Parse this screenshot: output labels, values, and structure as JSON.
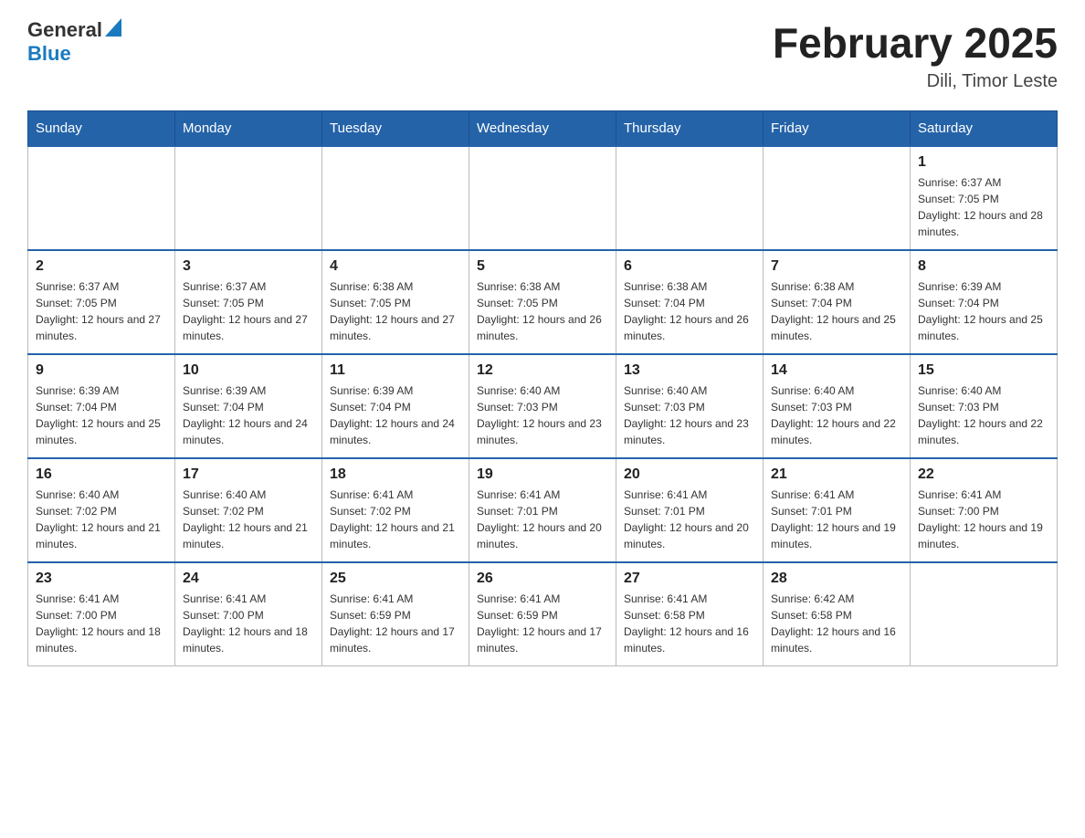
{
  "header": {
    "logo": {
      "general": "General",
      "arrow": "▲",
      "blue": "Blue"
    },
    "title": "February 2025",
    "location": "Dili, Timor Leste"
  },
  "days_of_week": [
    "Sunday",
    "Monday",
    "Tuesday",
    "Wednesday",
    "Thursday",
    "Friday",
    "Saturday"
  ],
  "weeks": [
    [
      {
        "day": "",
        "info": ""
      },
      {
        "day": "",
        "info": ""
      },
      {
        "day": "",
        "info": ""
      },
      {
        "day": "",
        "info": ""
      },
      {
        "day": "",
        "info": ""
      },
      {
        "day": "",
        "info": ""
      },
      {
        "day": "1",
        "info": "Sunrise: 6:37 AM\nSunset: 7:05 PM\nDaylight: 12 hours and 28 minutes."
      }
    ],
    [
      {
        "day": "2",
        "info": "Sunrise: 6:37 AM\nSunset: 7:05 PM\nDaylight: 12 hours and 27 minutes."
      },
      {
        "day": "3",
        "info": "Sunrise: 6:37 AM\nSunset: 7:05 PM\nDaylight: 12 hours and 27 minutes."
      },
      {
        "day": "4",
        "info": "Sunrise: 6:38 AM\nSunset: 7:05 PM\nDaylight: 12 hours and 27 minutes."
      },
      {
        "day": "5",
        "info": "Sunrise: 6:38 AM\nSunset: 7:05 PM\nDaylight: 12 hours and 26 minutes."
      },
      {
        "day": "6",
        "info": "Sunrise: 6:38 AM\nSunset: 7:04 PM\nDaylight: 12 hours and 26 minutes."
      },
      {
        "day": "7",
        "info": "Sunrise: 6:38 AM\nSunset: 7:04 PM\nDaylight: 12 hours and 25 minutes."
      },
      {
        "day": "8",
        "info": "Sunrise: 6:39 AM\nSunset: 7:04 PM\nDaylight: 12 hours and 25 minutes."
      }
    ],
    [
      {
        "day": "9",
        "info": "Sunrise: 6:39 AM\nSunset: 7:04 PM\nDaylight: 12 hours and 25 minutes."
      },
      {
        "day": "10",
        "info": "Sunrise: 6:39 AM\nSunset: 7:04 PM\nDaylight: 12 hours and 24 minutes."
      },
      {
        "day": "11",
        "info": "Sunrise: 6:39 AM\nSunset: 7:04 PM\nDaylight: 12 hours and 24 minutes."
      },
      {
        "day": "12",
        "info": "Sunrise: 6:40 AM\nSunset: 7:03 PM\nDaylight: 12 hours and 23 minutes."
      },
      {
        "day": "13",
        "info": "Sunrise: 6:40 AM\nSunset: 7:03 PM\nDaylight: 12 hours and 23 minutes."
      },
      {
        "day": "14",
        "info": "Sunrise: 6:40 AM\nSunset: 7:03 PM\nDaylight: 12 hours and 22 minutes."
      },
      {
        "day": "15",
        "info": "Sunrise: 6:40 AM\nSunset: 7:03 PM\nDaylight: 12 hours and 22 minutes."
      }
    ],
    [
      {
        "day": "16",
        "info": "Sunrise: 6:40 AM\nSunset: 7:02 PM\nDaylight: 12 hours and 21 minutes."
      },
      {
        "day": "17",
        "info": "Sunrise: 6:40 AM\nSunset: 7:02 PM\nDaylight: 12 hours and 21 minutes."
      },
      {
        "day": "18",
        "info": "Sunrise: 6:41 AM\nSunset: 7:02 PM\nDaylight: 12 hours and 21 minutes."
      },
      {
        "day": "19",
        "info": "Sunrise: 6:41 AM\nSunset: 7:01 PM\nDaylight: 12 hours and 20 minutes."
      },
      {
        "day": "20",
        "info": "Sunrise: 6:41 AM\nSunset: 7:01 PM\nDaylight: 12 hours and 20 minutes."
      },
      {
        "day": "21",
        "info": "Sunrise: 6:41 AM\nSunset: 7:01 PM\nDaylight: 12 hours and 19 minutes."
      },
      {
        "day": "22",
        "info": "Sunrise: 6:41 AM\nSunset: 7:00 PM\nDaylight: 12 hours and 19 minutes."
      }
    ],
    [
      {
        "day": "23",
        "info": "Sunrise: 6:41 AM\nSunset: 7:00 PM\nDaylight: 12 hours and 18 minutes."
      },
      {
        "day": "24",
        "info": "Sunrise: 6:41 AM\nSunset: 7:00 PM\nDaylight: 12 hours and 18 minutes."
      },
      {
        "day": "25",
        "info": "Sunrise: 6:41 AM\nSunset: 6:59 PM\nDaylight: 12 hours and 17 minutes."
      },
      {
        "day": "26",
        "info": "Sunrise: 6:41 AM\nSunset: 6:59 PM\nDaylight: 12 hours and 17 minutes."
      },
      {
        "day": "27",
        "info": "Sunrise: 6:41 AM\nSunset: 6:58 PM\nDaylight: 12 hours and 16 minutes."
      },
      {
        "day": "28",
        "info": "Sunrise: 6:42 AM\nSunset: 6:58 PM\nDaylight: 12 hours and 16 minutes."
      },
      {
        "day": "",
        "info": ""
      }
    ]
  ]
}
